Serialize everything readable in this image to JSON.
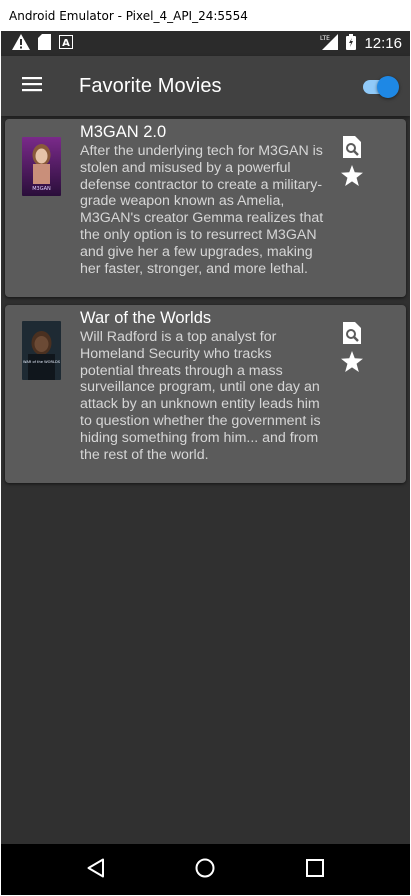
{
  "window": {
    "title": "Android Emulator - Pixel_4_API_24:5554"
  },
  "status_bar": {
    "time": "12:16",
    "network": "LTE",
    "icons": [
      "warning-icon",
      "sd-card-icon",
      "text-a-icon",
      "lte-signal-icon",
      "battery-icon"
    ]
  },
  "app_bar": {
    "title": "Favorite Movies",
    "menu_icon": "hamburger-menu-icon",
    "toggle": {
      "on": true,
      "accent": "#1e88e5",
      "track": "#90caf9"
    }
  },
  "movies": [
    {
      "title": "M3GAN 2.0",
      "poster_text": "M3GAN",
      "description": "After the underlying tech for M3GAN is stolen and misused by a powerful defense contractor to create a military-grade weapon known as Amelia, M3GAN's creator Gemma realizes that the only option is to resurrect M3GAN and give her a few upgrades, making her faster, stronger, and more lethal.",
      "actions": [
        "find-in-page-icon",
        "star-icon"
      ]
    },
    {
      "title": "War of the Worlds",
      "poster_text": "WAR of the WORLDS",
      "description": "Will Radford is a top analyst for Homeland Security who tracks potential threats through a mass surveillance program, until one day an attack by an unknown entity leads him to question whether the government is hiding something from him... and from the rest of the world.",
      "actions": [
        "find-in-page-icon",
        "star-icon"
      ]
    }
  ],
  "nav_bar": {
    "buttons": [
      "back-icon",
      "home-icon",
      "recents-icon"
    ]
  },
  "colors": {
    "background": "#303030",
    "app_bar": "#414141",
    "card": "#5b5b5b",
    "text_primary": "#ffffff",
    "text_secondary": "#d6d6d6"
  }
}
